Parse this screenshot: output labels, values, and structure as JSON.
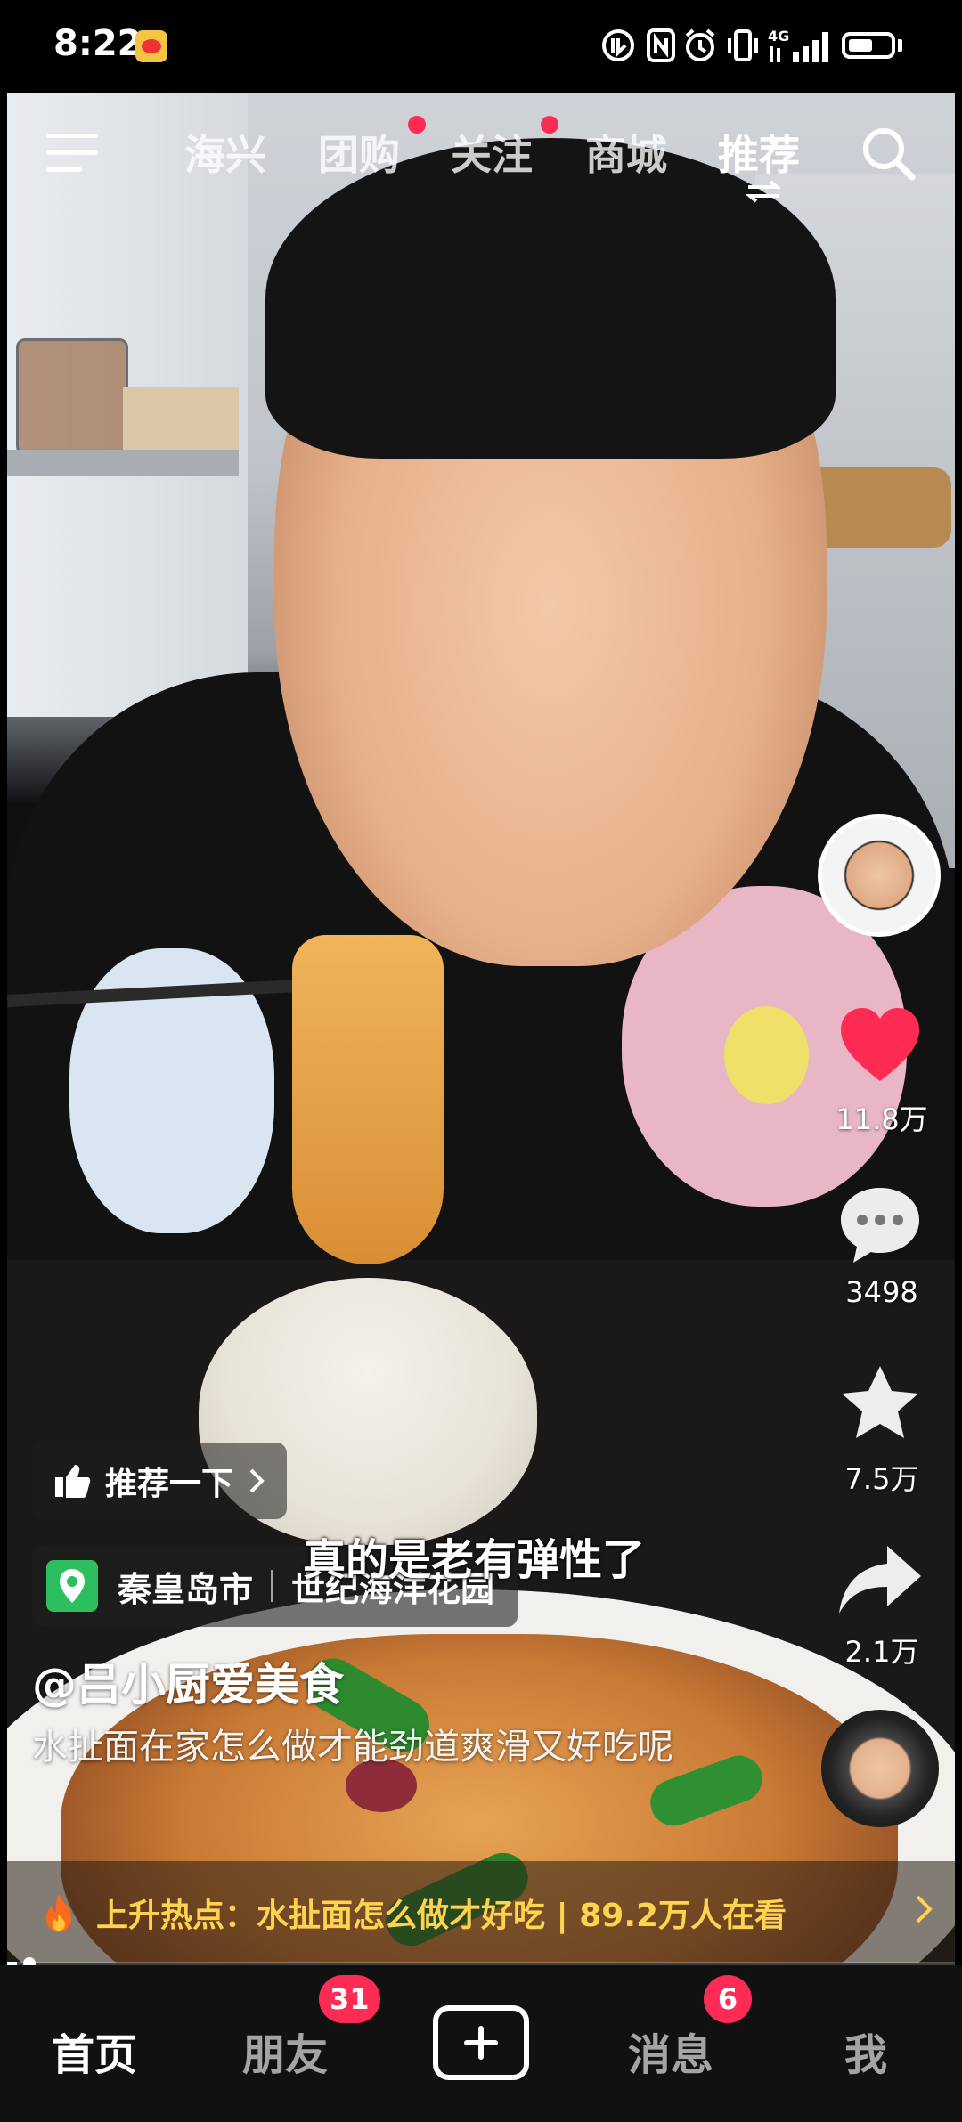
{
  "status_bar": {
    "time": "8:22",
    "icons": [
      "weibo-notification-icon",
      "hd-volte-icon",
      "nfc-icon",
      "alarm-icon",
      "vibrate-icon",
      "signal-4g-icon",
      "battery-icon"
    ],
    "network_label": "4G",
    "battery_level": 0.6
  },
  "top_nav": {
    "tabs": [
      {
        "label": "海兴",
        "dot": false
      },
      {
        "label": "团购",
        "dot": true
      },
      {
        "label": "关注",
        "dot": true
      },
      {
        "label": "商城",
        "dot": false
      },
      {
        "label": "推荐",
        "dot": false,
        "active": true
      }
    ],
    "icons": {
      "menu": "menu-icon",
      "search": "search-icon",
      "switch": "switch-arrows-icon"
    }
  },
  "video": {
    "subtitle": "真的是老有弹性了",
    "recommend_label": "推荐一下",
    "location": {
      "city": "秦皇岛市",
      "place": "世纪海洋花园"
    },
    "author": "@吕小厨爱美食",
    "description": "水扯面在家怎么做才能劲道爽滑又好吃呢",
    "progress": 0.01
  },
  "sidebar": {
    "likes": "11.8万",
    "comments": "3498",
    "favorites": "7.5万",
    "shares": "2.1万"
  },
  "hot_topic": {
    "prefix": "上升热点：",
    "text": "水扯面怎么做才好吃 | 89.2万人在看"
  },
  "bottom_nav": {
    "home": "首页",
    "friends": "朋友",
    "friends_badge": "31",
    "messages": "消息",
    "messages_badge": "6",
    "me": "我"
  },
  "colors": {
    "accent": "#fe2c55",
    "hot_text": "#ffd34d",
    "location_pin": "#2dbe5f"
  }
}
